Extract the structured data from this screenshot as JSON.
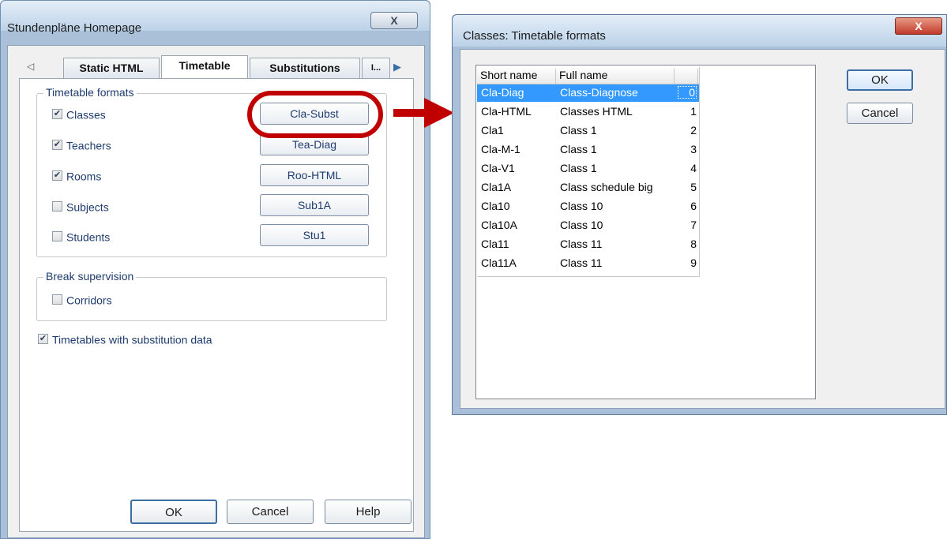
{
  "left_dialog": {
    "title": "Stundenpläne Homepage",
    "close_glyph": "X",
    "tabs": {
      "left_arrow": "◁",
      "items": [
        {
          "label": "Static HTML"
        },
        {
          "label": "Timetable",
          "active": true
        },
        {
          "label": "Substitutions"
        },
        {
          "label": "I..."
        }
      ],
      "right_arrow": "▶"
    },
    "timetable_formats": {
      "label": "Timetable formats",
      "rows": [
        {
          "label": "Classes",
          "checked": true,
          "format": "Cla-Subst"
        },
        {
          "label": "Teachers",
          "checked": true,
          "format": "Tea-Diag"
        },
        {
          "label": "Rooms",
          "checked": true,
          "format": "Roo-HTML"
        },
        {
          "label": "Subjects",
          "checked": false,
          "format": "Sub1A"
        },
        {
          "label": "Students",
          "checked": false,
          "format": "Stu1"
        }
      ]
    },
    "break_supervision": {
      "label": "Break supervision",
      "corridors_label": "Corridors",
      "corridors_checked": false
    },
    "substitution_data": {
      "label": "Timetables with substitution data",
      "checked": true
    },
    "buttons": {
      "ok": "OK",
      "cancel": "Cancel",
      "help": "Help"
    }
  },
  "right_dialog": {
    "title": "Classes: Timetable formats",
    "close_glyph": "X",
    "list": {
      "headers": [
        "Short name",
        "Full name",
        ""
      ],
      "selected_index": 0,
      "rows": [
        {
          "short": "Cla-Diag",
          "full": "Class-Diagnose",
          "num": "0"
        },
        {
          "short": "Cla-HTML",
          "full": "Classes HTML",
          "num": "1"
        },
        {
          "short": "Cla1",
          "full": "Class 1",
          "num": "2"
        },
        {
          "short": "Cla-M-1",
          "full": "Class 1",
          "num": "3"
        },
        {
          "short": "Cla-V1",
          "full": "Class 1",
          "num": "4"
        },
        {
          "short": "Cla1A",
          "full": "Class schedule big",
          "num": "5"
        },
        {
          "short": "Cla10",
          "full": "Class 10",
          "num": "6"
        },
        {
          "short": "Cla10A",
          "full": "Class 10",
          "num": "7"
        },
        {
          "short": "Cla11",
          "full": "Class 11",
          "num": "8"
        },
        {
          "short": "Cla11A",
          "full": "Class 11",
          "num": "9"
        }
      ]
    },
    "buttons": {
      "ok": "OK",
      "cancel": "Cancel"
    }
  },
  "colors": {
    "highlight": "#c00000",
    "selection": "#3399ff",
    "group_text": "#1e3c6e"
  }
}
